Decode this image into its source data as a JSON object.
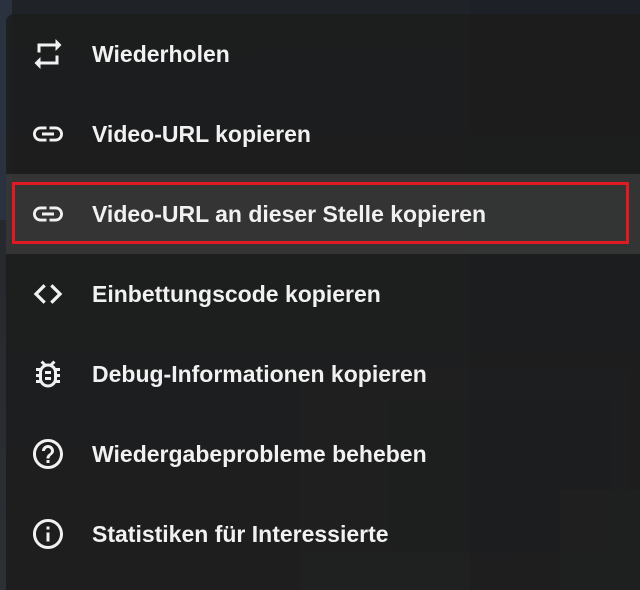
{
  "menu": {
    "items": [
      {
        "label": "Wiederholen",
        "icon": "loop-icon"
      },
      {
        "label": "Video-URL kopieren",
        "icon": "link-icon"
      },
      {
        "label": "Video-URL an dieser Stelle kopieren",
        "icon": "link-icon",
        "highlighted": true
      },
      {
        "label": "Einbettungscode kopieren",
        "icon": "code-icon"
      },
      {
        "label": "Debug-Informationen kopieren",
        "icon": "bug-icon"
      },
      {
        "label": "Wiedergabeprobleme beheben",
        "icon": "help-circle-icon"
      },
      {
        "label": "Statistiken für Interessierte",
        "icon": "info-circle-icon"
      }
    ]
  },
  "colors": {
    "menu_background": "#1c1c1c",
    "text": "#f1f1f1",
    "highlight_outline": "#e01a22"
  }
}
